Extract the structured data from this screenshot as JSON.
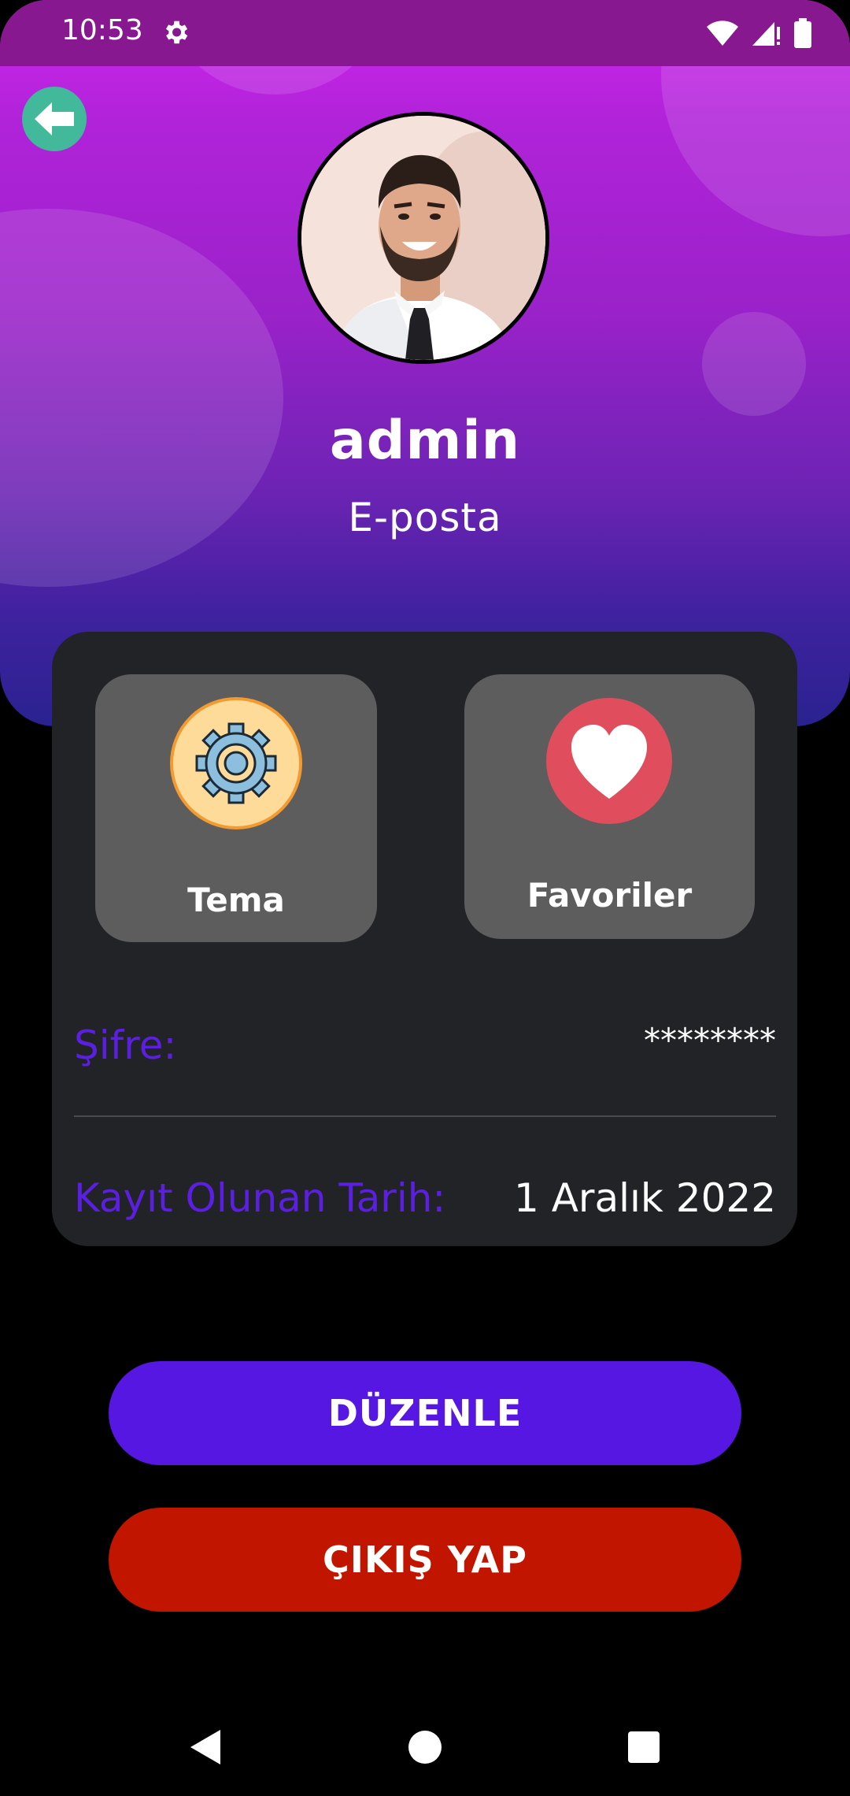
{
  "status_bar": {
    "time": "10:53",
    "icons": [
      "gear-icon",
      "wifi-icon",
      "signal-icon",
      "battery-icon"
    ]
  },
  "profile": {
    "username": "admin",
    "email_label": "E-posta"
  },
  "tiles": [
    {
      "label": "Tema",
      "icon": "gear-icon"
    },
    {
      "label": "Favoriler",
      "icon": "heart-icon"
    }
  ],
  "info": {
    "password_label": "Şifre:",
    "password_value": "********",
    "date_label": "Kayıt Olunan Tarih:",
    "date_value": "1 Aralık 2022"
  },
  "buttons": {
    "edit": "DÜZENLE",
    "logout": "ÇIKIŞ YAP"
  },
  "colors": {
    "accent_purple": "#5617e3",
    "logout_red": "#c21500",
    "back_green": "#41b99a",
    "label_purple": "#5a1fe0"
  }
}
